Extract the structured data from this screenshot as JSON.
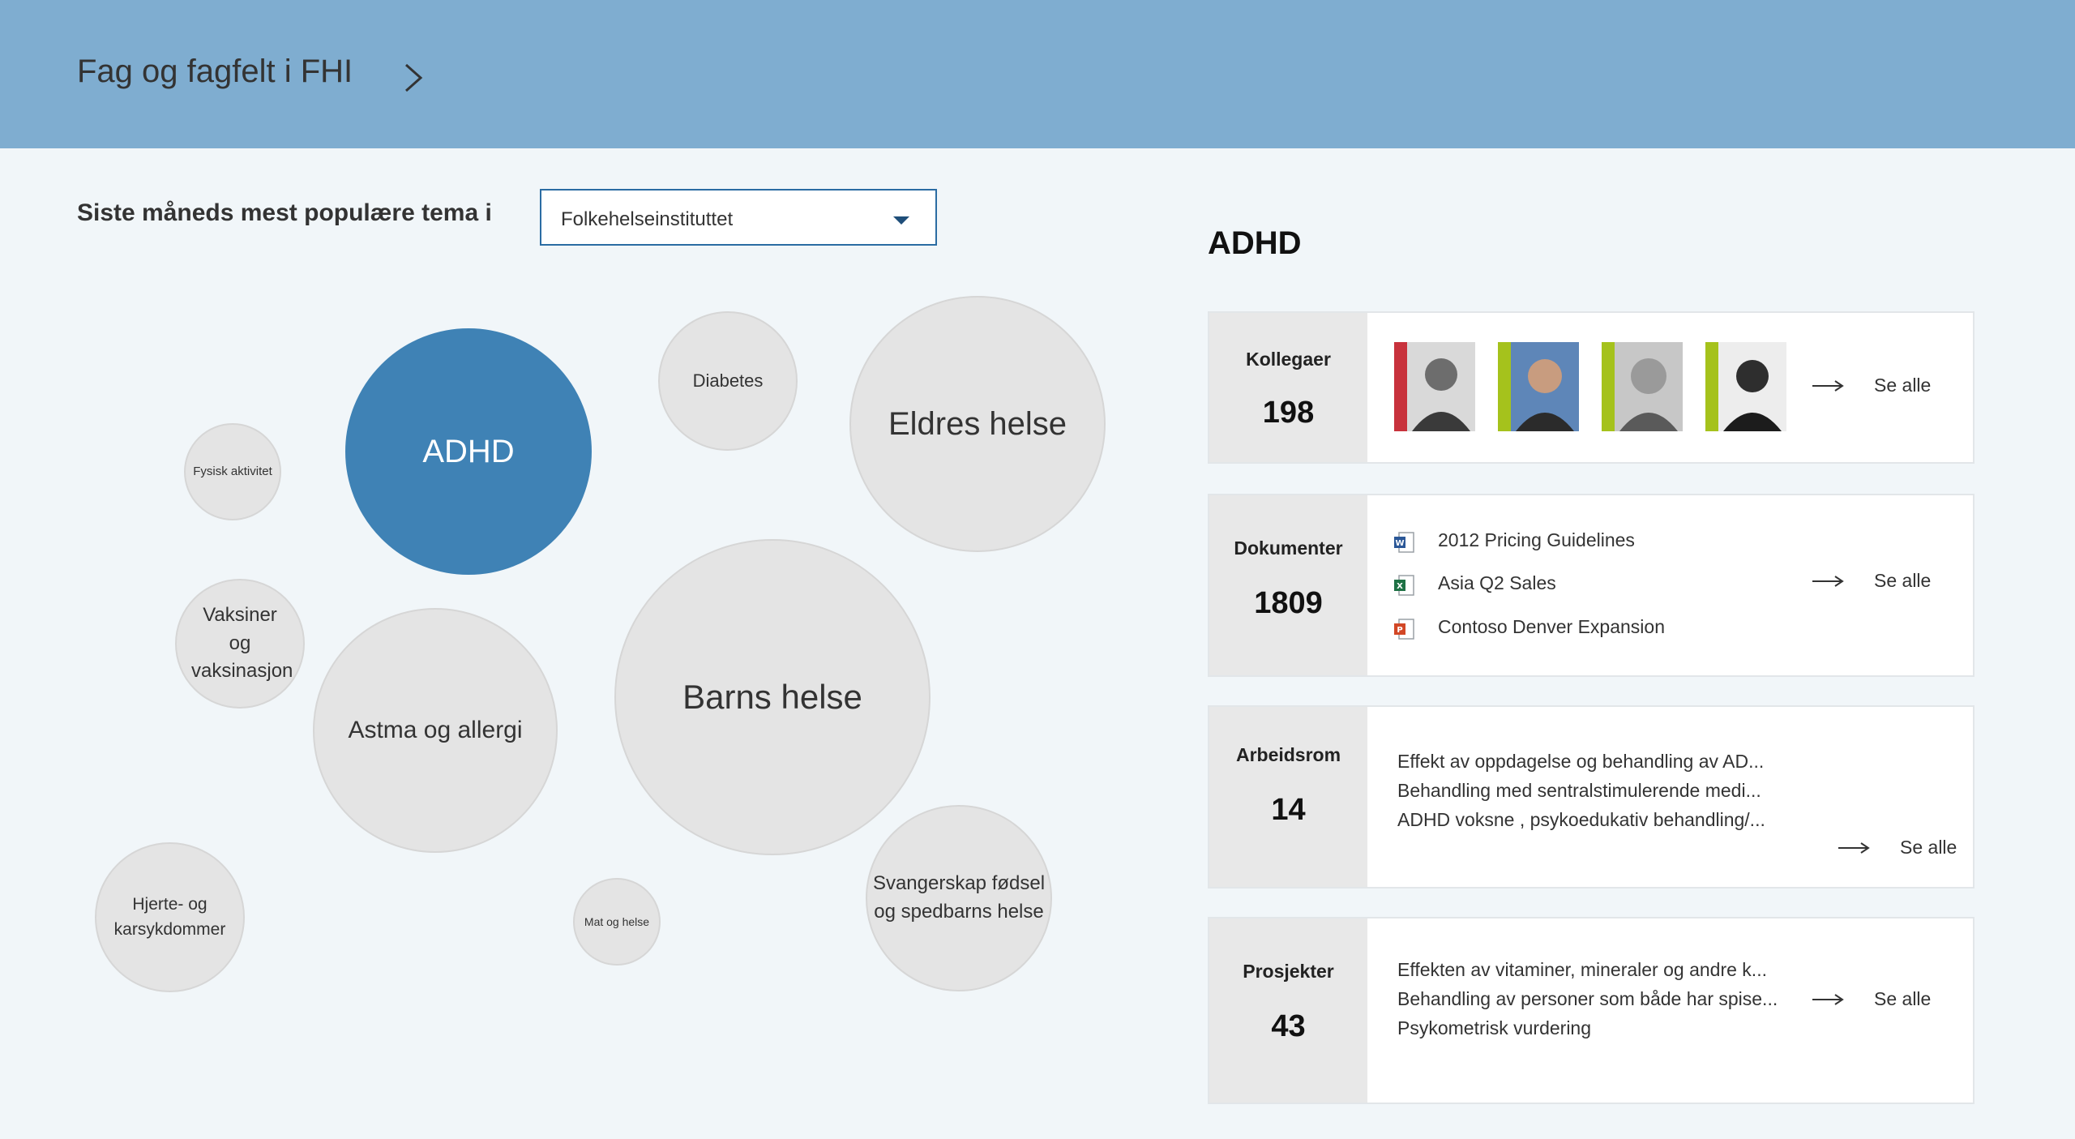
{
  "header": {
    "title": "Fag og fagfelt i FHI"
  },
  "filter": {
    "label": "Siste måneds mest populære tema i",
    "selected": "Folkehelseinstituttet"
  },
  "bubbles": [
    {
      "label": "ADHD",
      "active": true
    },
    {
      "label": "Diabetes"
    },
    {
      "label": "Eldres helse"
    },
    {
      "label": "Fysisk aktivitet"
    },
    {
      "label": "Vaksiner og vaksinasjon"
    },
    {
      "label": "Astma og allergi"
    },
    {
      "label": "Barns helse"
    },
    {
      "label": "Svangerskap fødsel og spedbarns helse"
    },
    {
      "label": "Hjerte- og karsykdommer"
    },
    {
      "label": "Mat og helse"
    }
  ],
  "detail": {
    "title": "ADHD",
    "see_all": "Se alle",
    "colleagues": {
      "label": "Kollegaer",
      "count": "198",
      "avatars": [
        {
          "accent": "#c8323c"
        },
        {
          "accent": "#a5c21c"
        },
        {
          "accent": "#a5c21c"
        },
        {
          "accent": "#a5c21c"
        }
      ]
    },
    "documents": {
      "label": "Dokumenter",
      "count": "1809",
      "items": [
        {
          "name": "2012 Pricing Guidelines",
          "icon": "word-document-icon",
          "color": "#2b5797"
        },
        {
          "name": "Asia Q2 Sales",
          "icon": "excel-document-icon",
          "color": "#1e7145"
        },
        {
          "name": "Contoso Denver Expansion",
          "icon": "powerpoint-document-icon",
          "color": "#d24726"
        }
      ]
    },
    "workspaces": {
      "label": "Arbeidsrom",
      "count": "14",
      "items": [
        "Effekt av oppdagelse og behandling av AD...",
        "Behandling med sentralstimulerende medi...",
        "ADHD voksne , psykoedukativ behandling/..."
      ]
    },
    "projects": {
      "label": "Prosjekter",
      "count": "43",
      "items": [
        "Effekten av vitaminer, mineraler og andre k...",
        "Behandling av personer som både har spise...",
        "Psykometrisk vurdering"
      ]
    }
  }
}
